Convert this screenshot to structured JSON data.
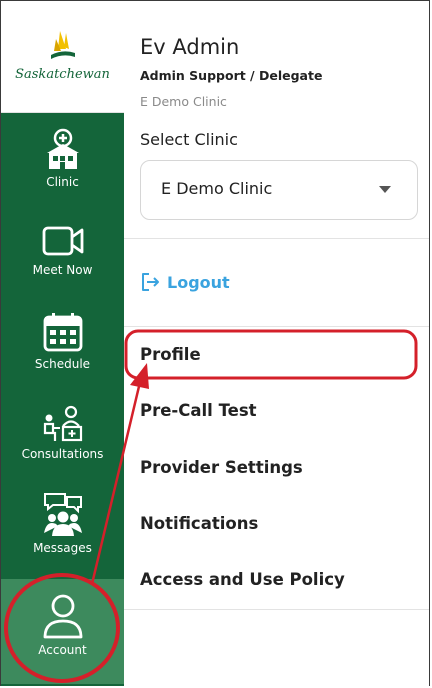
{
  "sidebar": {
    "logo_text": "Saskatchewan",
    "items": [
      {
        "label": "Clinic",
        "icon": "clinic-icon"
      },
      {
        "label": "Meet Now",
        "icon": "video-camera-icon"
      },
      {
        "label": "Schedule",
        "icon": "calendar-icon"
      },
      {
        "label": "Consultations",
        "icon": "consultation-icon"
      },
      {
        "label": "Messages",
        "icon": "messages-group-icon"
      },
      {
        "label": "Account",
        "icon": "user-icon",
        "active": true
      }
    ]
  },
  "user": {
    "name": "Ev Admin",
    "role": "Admin Support / Delegate",
    "clinic": "E Demo Clinic"
  },
  "clinic_select": {
    "label": "Select Clinic",
    "value": "E Demo Clinic"
  },
  "logout": {
    "label": "Logout",
    "icon": "logout-icon"
  },
  "menu": {
    "items": [
      "Profile",
      "Pre-Call Test",
      "Provider Settings",
      "Notifications",
      "Access and Use Policy"
    ]
  },
  "colors": {
    "sidebar_green": "#14653a",
    "active_green": "#3d8a5d",
    "logout_blue": "#3aa3df",
    "annotation_red": "#d4202a",
    "logo_yellow": "#f2c000"
  }
}
